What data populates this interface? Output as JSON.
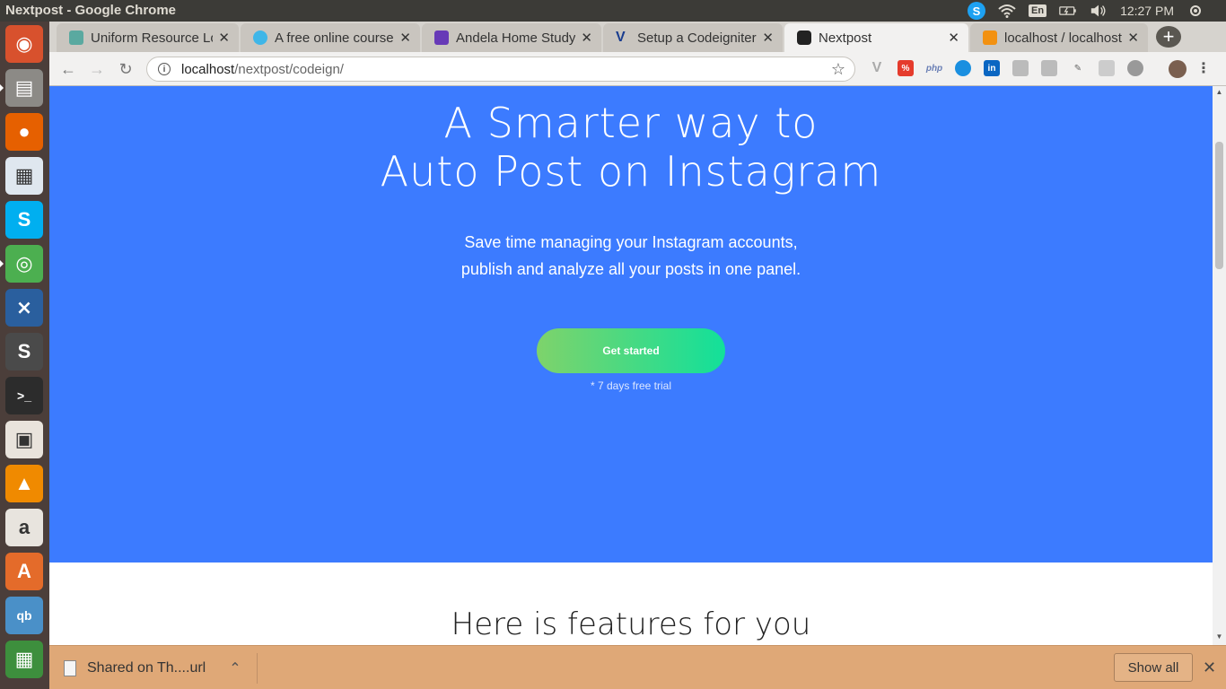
{
  "window": {
    "title": "Nextpost - Google Chrome"
  },
  "tray": {
    "language": "En",
    "time": "12:27 PM"
  },
  "tabs": [
    {
      "label": "Uniform Resource Lo",
      "favicon_color": "#5aa9a0"
    },
    {
      "label": "A free online course",
      "favicon_color": "#3fb6e8"
    },
    {
      "label": "Andela Home Study",
      "favicon_color": "#673ab7"
    },
    {
      "label": "Setup a Codeigniter",
      "favicon_color": "#1a3d8f"
    },
    {
      "label": "Nextpost",
      "favicon_color": "#222222"
    },
    {
      "label": "localhost / localhost",
      "favicon_color": "#f29111"
    }
  ],
  "active_tab_index": 4,
  "omnibox": {
    "host": "localhost",
    "path": "/nextpost/codeign/"
  },
  "hero": {
    "title_line1": "A Smarter way to",
    "title_line2": "Auto Post on Instagram",
    "subtitle_line1": "Save time managing your Instagram accounts,",
    "subtitle_line2": "publish and analyze all your posts in one panel.",
    "cta_label": "Get started",
    "trial_note": "* 7 days free trial",
    "background": "#3c7bff"
  },
  "features": {
    "heading": "Here is features for you"
  },
  "downloads": {
    "item_label": "Shared on Th....url",
    "show_all_label": "Show all"
  },
  "launcher": [
    {
      "name": "ubuntu-dash-icon",
      "glyph": "◉",
      "color": "#d8512d"
    },
    {
      "name": "files-icon",
      "glyph": "▤",
      "color": "#8c8a86"
    },
    {
      "name": "firefox-icon",
      "glyph": "●",
      "color": "#e66000"
    },
    {
      "name": "libreoffice-writer-icon",
      "glyph": "▦",
      "color": "#dfe7ef"
    },
    {
      "name": "skype-icon",
      "glyph": "S",
      "color": "#00aff0"
    },
    {
      "name": "chrome-icon",
      "glyph": "◎",
      "color": "#4caf50"
    },
    {
      "name": "vscode-icon",
      "glyph": "⨯",
      "color": "#2a5f9e"
    },
    {
      "name": "sublime-text-icon",
      "glyph": "S",
      "color": "#4a4a4a"
    },
    {
      "name": "terminal-icon",
      "glyph": ">_",
      "color": "#2c2c2c"
    },
    {
      "name": "impress-icon",
      "glyph": "▣",
      "color": "#e9e3dc"
    },
    {
      "name": "vlc-icon",
      "glyph": "▲",
      "color": "#f08a00"
    },
    {
      "name": "amazon-icon",
      "glyph": "a",
      "color": "#e8e4de"
    },
    {
      "name": "software-center-icon",
      "glyph": "A",
      "color": "#e46b2a"
    },
    {
      "name": "qbittorrent-icon",
      "glyph": "qb",
      "color": "#4a90c8"
    },
    {
      "name": "spreadsheet-icon",
      "glyph": "▦",
      "color": "#3d8f3d"
    }
  ]
}
